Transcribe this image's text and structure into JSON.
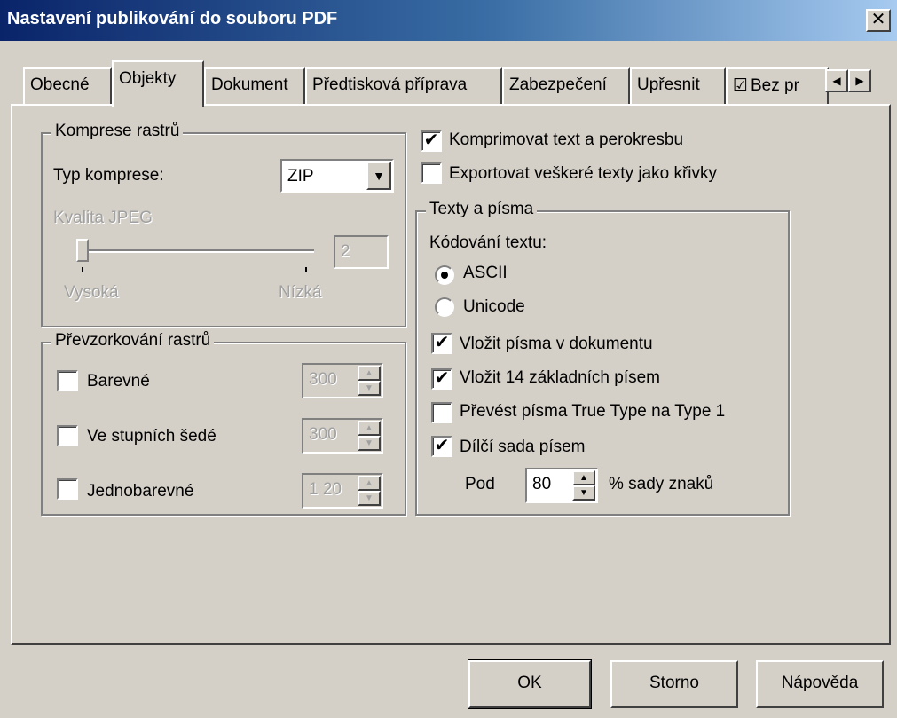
{
  "window": {
    "title": "Nastavení publikování do souboru PDF"
  },
  "tabs": [
    "Obecné",
    "Objekty",
    "Dokument",
    "Předtisková příprava",
    "Zabezpečení",
    "Upřesnit",
    "Bez pr"
  ],
  "active_tab": "Objekty",
  "raster_compression": {
    "legend": "Komprese rastrů",
    "type_label": "Typ komprese:",
    "type_value": "ZIP",
    "jpeg_quality_label": "Kvalita JPEG",
    "jpeg_quality_value": "2",
    "slider_high": "Vysoká",
    "slider_low": "Nízká"
  },
  "resampling": {
    "legend": "Převzorkování rastrů",
    "color_label": "Barevné",
    "color_checked": false,
    "color_value": "300",
    "gray_label": "Ve stupních šedé",
    "gray_checked": false,
    "gray_value": "300",
    "mono_label": "Jednobarevné",
    "mono_checked": false,
    "mono_value": "1 20"
  },
  "compress_text": {
    "label": "Komprimovat text a perokresbu",
    "checked": true
  },
  "export_curves": {
    "label": "Exportovat veškeré texty jako křivky",
    "checked": false
  },
  "text_fonts": {
    "legend": "Texty a písma",
    "encoding_label": "Kódování textu:",
    "ascii_label": "ASCII",
    "ascii_selected": true,
    "unicode_label": "Unicode",
    "unicode_selected": false,
    "embed_fonts": "Vložit písma v dokumentu",
    "embed_fonts_checked": true,
    "embed_base14": "Vložit 14 základních písem",
    "embed_base14_checked": true,
    "convert_truetype": "Převést písma True Type na Type 1",
    "convert_truetype_checked": false,
    "subset": "Dílčí sada písem",
    "subset_checked": true,
    "under_label": "Pod",
    "under_value": "80",
    "percent_label": "% sady znaků"
  },
  "buttons": {
    "ok": "OK",
    "cancel": "Storno",
    "help": "Nápověda"
  },
  "icons": {
    "close": "close-icon",
    "checklist": "checklist-icon",
    "scroll_left": "arrow-left-icon",
    "scroll_right": "arrow-right-icon"
  }
}
